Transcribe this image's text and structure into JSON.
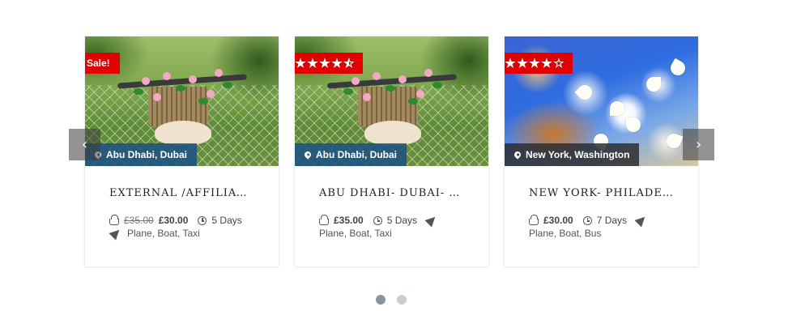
{
  "cards": [
    {
      "badge_text": "Sale!",
      "badge_type": "sale",
      "location": "Abu Dhabi, Dubai",
      "title": "External /Affiliate /",
      "old_price": "£35.00",
      "price": "£30.00",
      "duration": "5 Days",
      "transport": "Plane, Boat, Taxi"
    },
    {
      "badge_type": "rating",
      "rating": 4.5,
      "location": "Abu Dhabi, Dubai",
      "title": "Abu Dhabi- Dubai- H",
      "price": "£35.00",
      "duration": "5 Days",
      "transport": "Plane, Boat, Taxi"
    },
    {
      "badge_type": "rating",
      "rating": 4,
      "location": "New York, Washington",
      "title": "New York- Philadelp",
      "price": "£30.00",
      "duration": "7 Days",
      "transport": "Plane, Boat, Bus"
    }
  ],
  "ellipsis": "...",
  "nav": {
    "prev_glyph": "‹",
    "next_glyph": "›"
  },
  "pagination": {
    "total_pages": 2,
    "active_page": 1
  },
  "icons": {
    "badge": "ribbon",
    "location": "map-pin-icon",
    "price": "basket-icon",
    "duration": "clock-icon",
    "transport": "plane-icon"
  },
  "colors": {
    "badge": "#e00000",
    "location_bar": "#1b5282",
    "location_bar_dark": "#282828",
    "dot_active": "#86969c",
    "dot_inactive": "#c3ced2"
  }
}
